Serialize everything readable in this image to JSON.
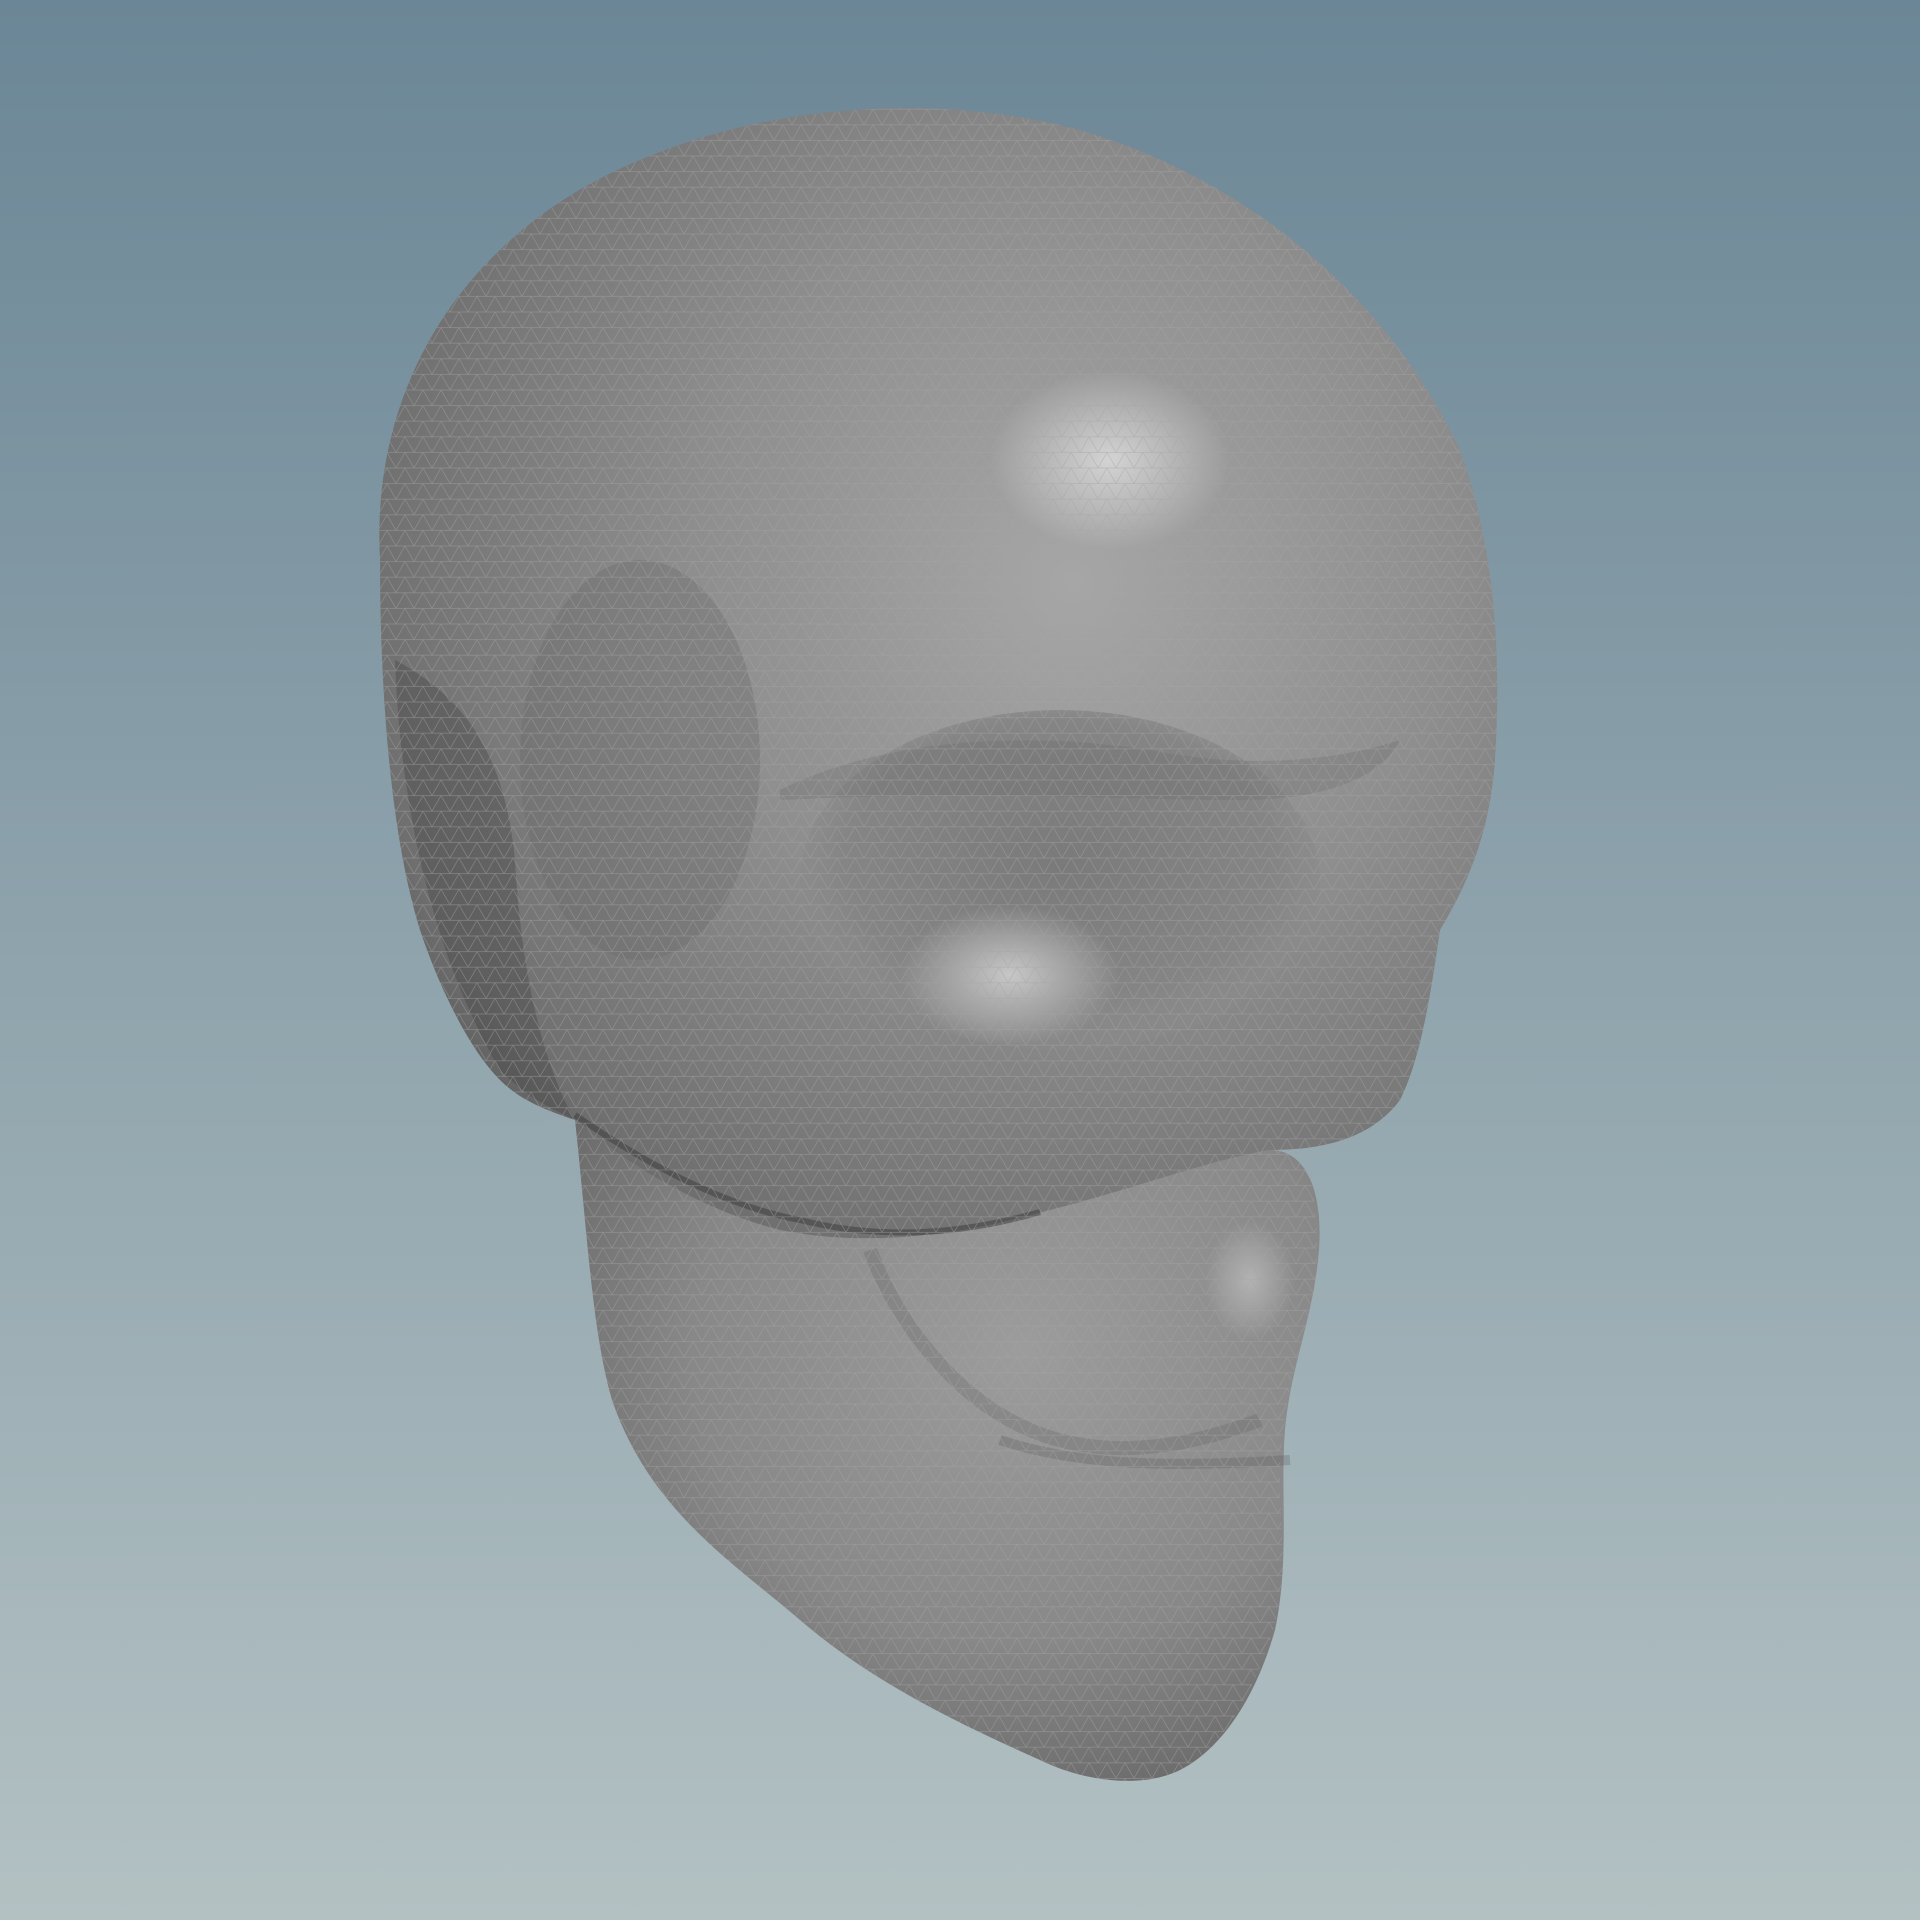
{
  "viewport": {
    "background_top_color": "#6b8696",
    "background_bottom_color": "#b3c1c3"
  },
  "model": {
    "subject": "skull-mesh",
    "surface_color": "#8a8a8a",
    "wireframe_color": "#a4a4a4",
    "wireframe_visible": true,
    "shading": "smooth-gray-with-triangle-wireframe"
  }
}
